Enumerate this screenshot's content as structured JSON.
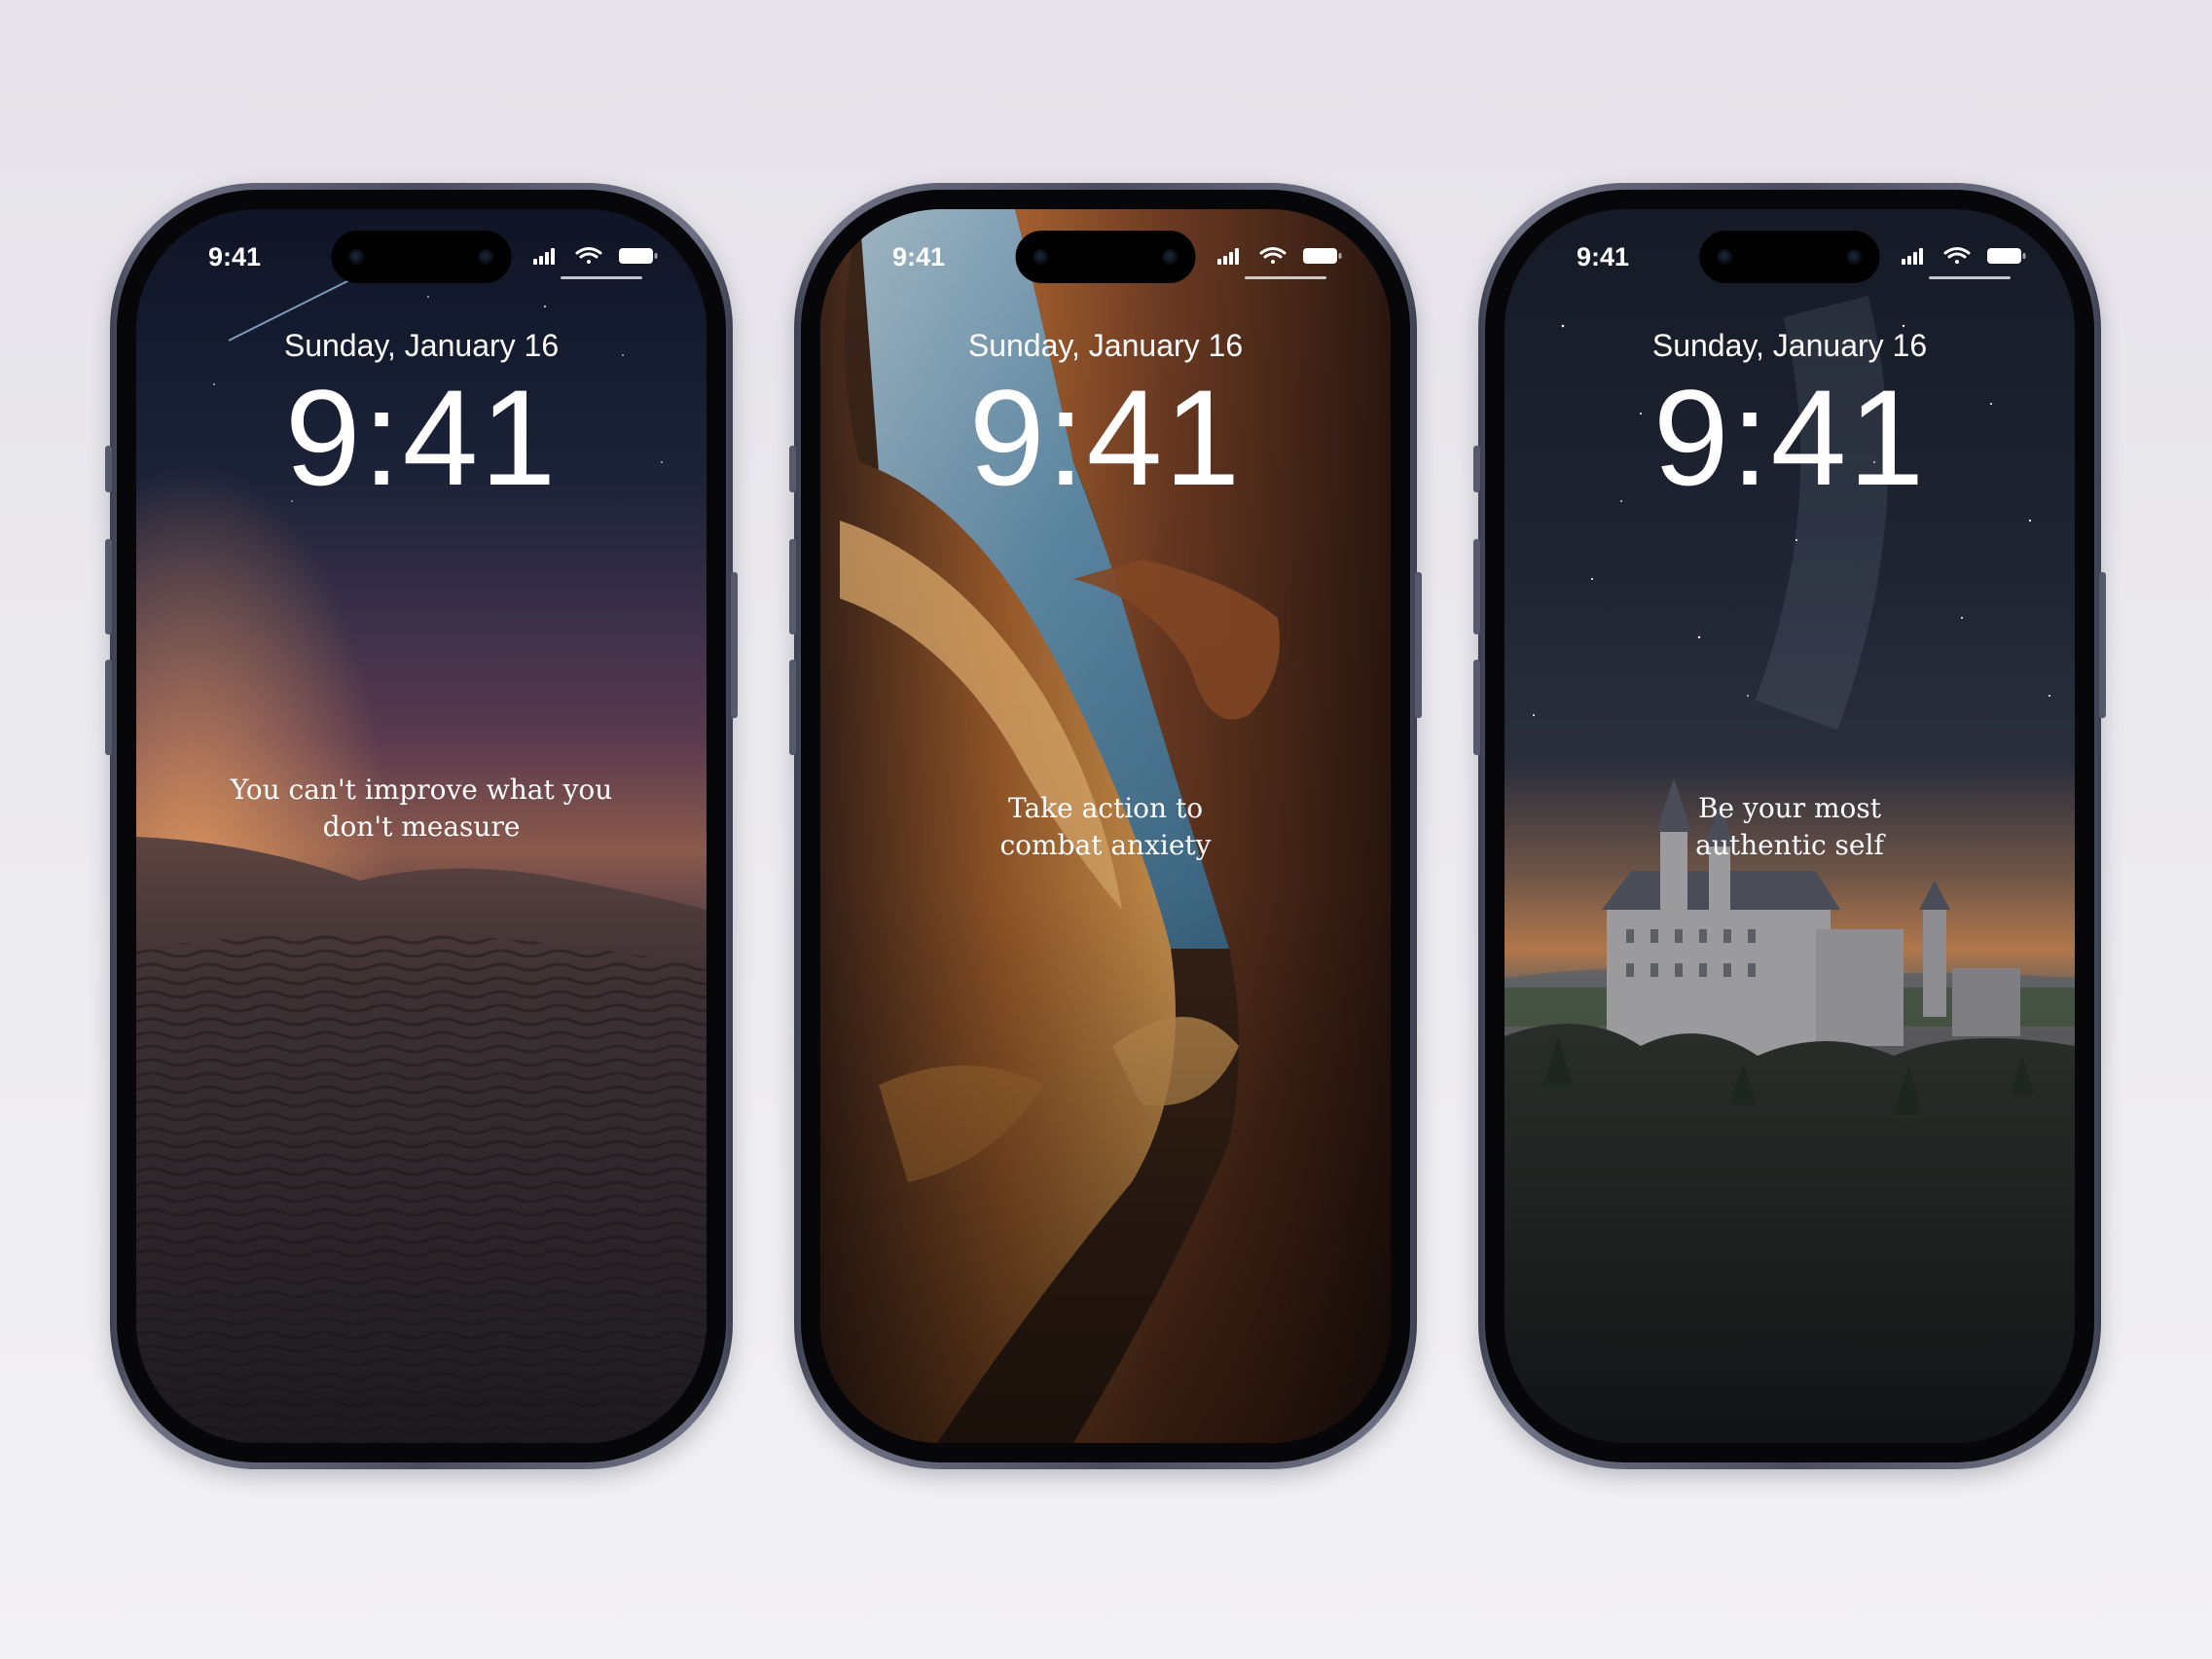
{
  "phones": [
    {
      "status_time": "9:41",
      "date": "Sunday, January 16",
      "clock": "9:41",
      "quote": "You can't improve what you don't measure",
      "wallpaper": "desert dunes at dusk"
    },
    {
      "status_time": "9:41",
      "date": "Sunday, January 16",
      "clock": "9:41",
      "quote": "Take action to combat anxiety",
      "wallpaper": "sandstone slot canyon"
    },
    {
      "status_time": "9:41",
      "date": "Sunday, January 16",
      "clock": "9:41",
      "quote": "Be your most authentic self",
      "wallpaper": "castle under starry sky"
    }
  ],
  "status_icons": [
    "signal-icon",
    "wifi-icon",
    "battery-icon"
  ],
  "colors": {
    "background": "#e9e8ec",
    "frame": "#5d6073",
    "bezel": "#07070a",
    "text": "#ffffff"
  }
}
